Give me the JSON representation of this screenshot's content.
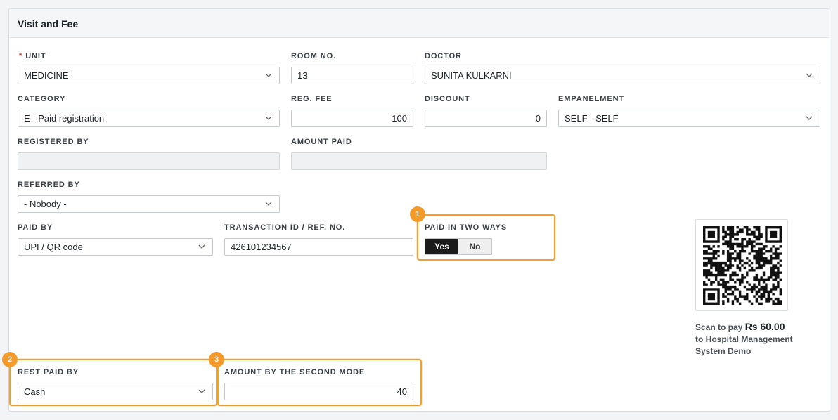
{
  "panel": {
    "title": "Visit and Fee"
  },
  "form": {
    "unit": {
      "label": "UNIT",
      "required_mark": "*",
      "value": "MEDICINE"
    },
    "room_no": {
      "label": "ROOM NO.",
      "value": "13"
    },
    "doctor": {
      "label": "DOCTOR",
      "value": "SUNITA KULKARNI"
    },
    "category": {
      "label": "CATEGORY",
      "value": "E - Paid registration"
    },
    "reg_fee": {
      "label": "REG. FEE",
      "value": "100"
    },
    "discount": {
      "label": "DISCOUNT",
      "value": "0"
    },
    "empanelment": {
      "label": "EMPANELMENT",
      "value": "SELF - SELF"
    },
    "registered_by": {
      "label": "REGISTERED BY",
      "value": ""
    },
    "amount_paid": {
      "label": "AMOUNT PAID",
      "value": ""
    },
    "referred_by": {
      "label": "REFERRED BY",
      "value": "- Nobody -"
    },
    "paid_by": {
      "label": "PAID BY",
      "value": "UPI / QR code"
    },
    "transaction_id": {
      "label": "TRANSACTION ID / REF. NO.",
      "value": "426101234567"
    },
    "paid_two_ways": {
      "label": "PAID IN TWO WAYS",
      "yes": "Yes",
      "no": "No",
      "selected": "Yes"
    },
    "rest_paid_by": {
      "label": "REST PAID BY",
      "value": "Cash"
    },
    "second_amount": {
      "label": "AMOUNT BY THE SECOND MODE",
      "value": "40"
    }
  },
  "badges": {
    "b1": "1",
    "b2": "2",
    "b3": "3"
  },
  "qr": {
    "prefix": "Scan to pay ",
    "amount": "Rs 60.00",
    "line2": "to Hospital Management System Demo"
  },
  "colors": {
    "highlight": "#f0a030",
    "badge": "#f39a2b",
    "toggle_on": "#1b1b1b"
  }
}
